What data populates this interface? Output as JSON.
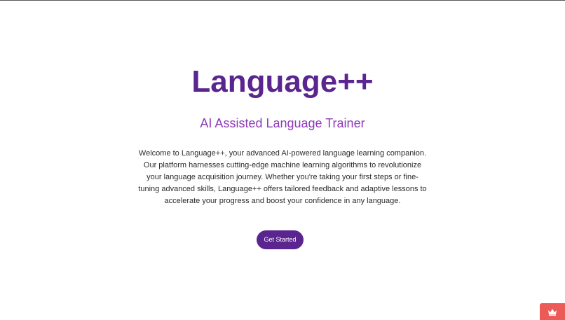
{
  "hero": {
    "title": "Language++",
    "subtitle": "AI Assisted Language Trainer",
    "description": "Welcome to Language++, your advanced AI-powered language learning companion. Our platform harnesses cutting-edge machine learning algorithms to revolutionize your language acquisition journey. Whether you're taking your first steps or fine-tuning advanced skills, Language++ offers tailored feedback and adaptive lessons to accelerate your progress and boost your confidence in any language.",
    "cta_label": "Get Started"
  },
  "widget": {
    "icon": "crown-icon"
  },
  "colors": {
    "brand": "#5b2590",
    "subtitle": "#8f3bb8",
    "widget": "#ec5b57"
  }
}
